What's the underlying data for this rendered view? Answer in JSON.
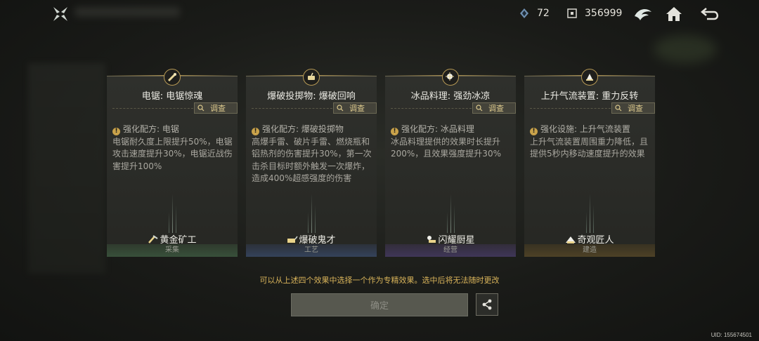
{
  "header": {
    "gem_count": "72",
    "coin_count": "356999",
    "icons": [
      "logo-icon",
      "gem-icon",
      "coin-icon",
      "wing-icon",
      "home-icon",
      "back-icon"
    ]
  },
  "cards": [
    {
      "title": "电锯: 电锯惊魂",
      "inspect_label": "调查",
      "desc_line1": "强化配方: 电锯",
      "desc_body": "电锯耐久度上限提升50%，电锯攻击速度提升30%，电锯近战伤害提升100%",
      "talent_name": "黄金矿工",
      "category": "采集",
      "icon": "chainsaw-icon"
    },
    {
      "title": "爆破投掷物: 爆破回响",
      "inspect_label": "调查",
      "desc_line1": "强化配方: 爆破投掷物",
      "desc_body": "高爆手雷、破片手雷、燃烧瓶和铝热剂的伤害提升30%，第一次击杀目标时额外触发一次爆炸，造成400%超感强度的伤害",
      "talent_name": "爆破鬼才",
      "category": "工艺",
      "icon": "explosive-icon"
    },
    {
      "title": "冰品料理: 强劲冰凉",
      "inspect_label": "调查",
      "desc_line1": "强化配方: 冰品料理",
      "desc_body": "冰品料理提供的效果时长提升200%，且效果强度提升30%",
      "talent_name": "闪耀厨星",
      "category": "经营",
      "icon": "ice-food-icon"
    },
    {
      "title": "上升气流装置: 重力反转",
      "inspect_label": "调查",
      "desc_line1": "强化设施: 上升气流装置",
      "desc_body": "上升气流装置周围重力降低，且提供5秒内移动速度提升的效果",
      "talent_name": "奇观匠人",
      "category": "建造",
      "icon": "updraft-icon"
    }
  ],
  "footer": {
    "hint": "可以从上述四个效果中选择一个作为专精效果。选中后将无法随时更改",
    "confirm_label": "确定",
    "uid": "UID: 155674501"
  },
  "colors": {
    "accent_gold": "#d9b45a",
    "collect": "#38503a",
    "craft": "#34425a",
    "manage": "#3f3658",
    "build": "#4d4126"
  }
}
